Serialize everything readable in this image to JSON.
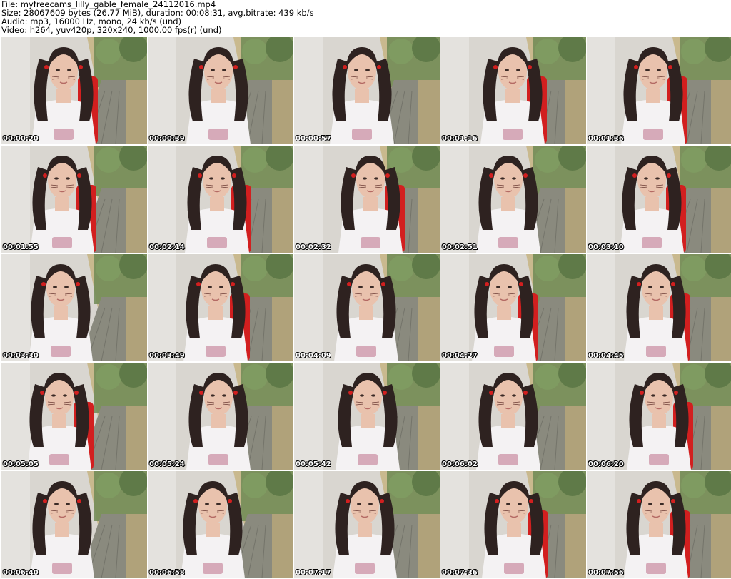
{
  "header": {
    "file_line": "File: myfreecams_lilly_gable_female_24112016.mp4",
    "size_line": "Size: 28067609 bytes (26.77 MiB), duration: 00:08:31, avg.bitrate: 439 kb/s",
    "audio_line": "Audio: mp3, 16000 Hz, mono, 24 kb/s (und)",
    "video_line": "Video: h264, yuv420p, 320x240, 1000.00 fps(r) (und)"
  },
  "colors": {
    "wall": "#d9d6d0",
    "foliage": "#6e8a55",
    "path": "#8a8a7e",
    "chair": "#d21f1f",
    "shirt": "#f4f2f3",
    "hair": "#2e2220",
    "skin": "#e9c2ad"
  },
  "frames": [
    {
      "time": "00:00:20"
    },
    {
      "time": "00:00:39"
    },
    {
      "time": "00:00:57"
    },
    {
      "time": "00:01:16"
    },
    {
      "time": "00:01:36"
    },
    {
      "time": "00:01:55"
    },
    {
      "time": "00:02:14"
    },
    {
      "time": "00:02:32"
    },
    {
      "time": "00:02:51"
    },
    {
      "time": "00:03:10"
    },
    {
      "time": "00:03:30"
    },
    {
      "time": "00:03:49"
    },
    {
      "time": "00:04:09"
    },
    {
      "time": "00:04:27"
    },
    {
      "time": "00:04:45"
    },
    {
      "time": "00:05:05"
    },
    {
      "time": "00:05:24"
    },
    {
      "time": "00:05:42"
    },
    {
      "time": "00:06:02"
    },
    {
      "time": "00:06:20"
    },
    {
      "time": "00:06:40"
    },
    {
      "time": "00:06:58"
    },
    {
      "time": "00:07:17"
    },
    {
      "time": "00:07:36"
    },
    {
      "time": "00:07:56"
    }
  ]
}
